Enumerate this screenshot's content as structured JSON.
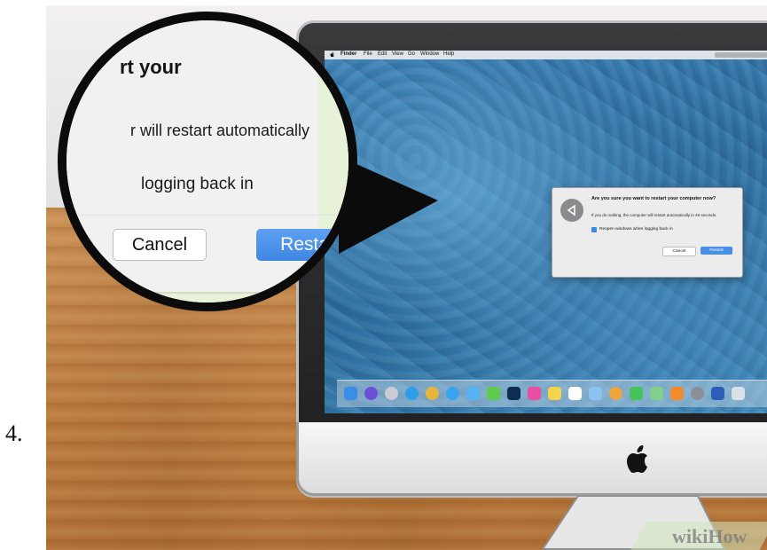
{
  "step": {
    "number": "4."
  },
  "screen": {
    "menubar": {
      "items": [
        "Finder",
        "File",
        "Edit",
        "View",
        "Go",
        "Window",
        "Help"
      ]
    },
    "dialog": {
      "title": "Are you sure you want to restart your computer now?",
      "message": "If you do nothing, the computer will restart automatically in 49 seconds.",
      "checkbox_label": "Reopen windows when logging back in",
      "checkbox_checked": true,
      "cancel_label": "Cancel",
      "restart_label": "Restart",
      "accent_color": "#4a8fe7"
    },
    "dock_icons": [
      "finder-icon",
      "siri-icon",
      "launchpad-icon",
      "safari-icon",
      "chrome-icon",
      "app-store-icon",
      "mail-icon",
      "messages-icon",
      "photoshop-icon",
      "itunes-icon",
      "notes-icon",
      "calendar-icon",
      "preview-icon",
      "photos-icon",
      "facetime-icon",
      "maps-icon",
      "ibooks-icon",
      "system-preferences-icon",
      "word-icon",
      "trash-icon"
    ]
  },
  "magnifier": {
    "title_fragment": "rt your",
    "text_line1": "r will restart automatically",
    "text_line2": "logging back in",
    "cancel_label": "Cancel",
    "restart_label": "Restart"
  },
  "watermark": {
    "text": "wikiHow"
  }
}
